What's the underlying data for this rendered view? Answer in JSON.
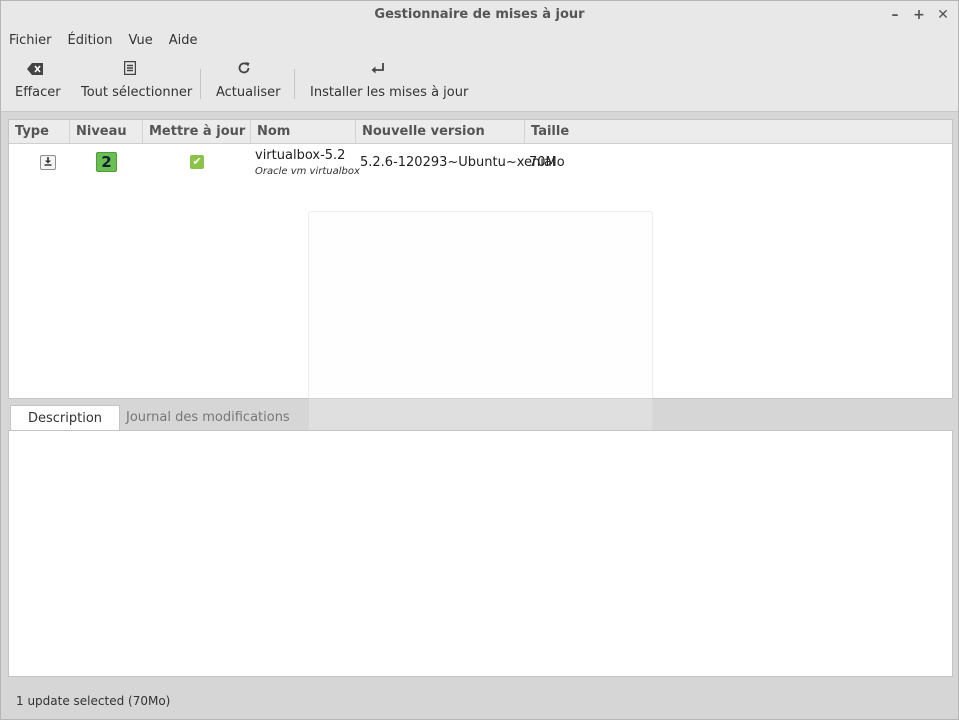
{
  "window": {
    "title": "Gestionnaire de mises à jour",
    "controls": [
      "–",
      "+",
      "✕"
    ]
  },
  "menubar": {
    "items": [
      "Fichier",
      "Édition",
      "Vue",
      "Aide"
    ]
  },
  "toolbar": {
    "clear": {
      "label": "Effacer",
      "icon": "backspace-icon"
    },
    "select_all": {
      "label": "Tout sélectionner",
      "icon": "document-icon"
    },
    "refresh": {
      "label": "Actualiser",
      "icon": "refresh-icon"
    },
    "install": {
      "label": "Installer les mises à jour",
      "icon": "enter-arrow-icon"
    }
  },
  "table": {
    "columns": [
      "Type",
      "Niveau",
      "Mettre à jour",
      "Nom",
      "Nouvelle version",
      "Taille"
    ],
    "rows": [
      {
        "type_icon": "package-update-icon",
        "level": "2",
        "selected": true,
        "name": "virtualbox-5.2",
        "description": "Oracle vm virtualbox",
        "new_version": "5.2.6-120293~Ubuntu~xenial",
        "size": "70Mo"
      }
    ]
  },
  "tabs": {
    "description": "Description",
    "changelog": "Journal des modifications"
  },
  "status": {
    "text": "1 update selected (70Mo)"
  },
  "colors": {
    "level_badge": "#6bbf52",
    "checkbox": "#8bc34a",
    "window_bg": "#d6d6d6"
  }
}
